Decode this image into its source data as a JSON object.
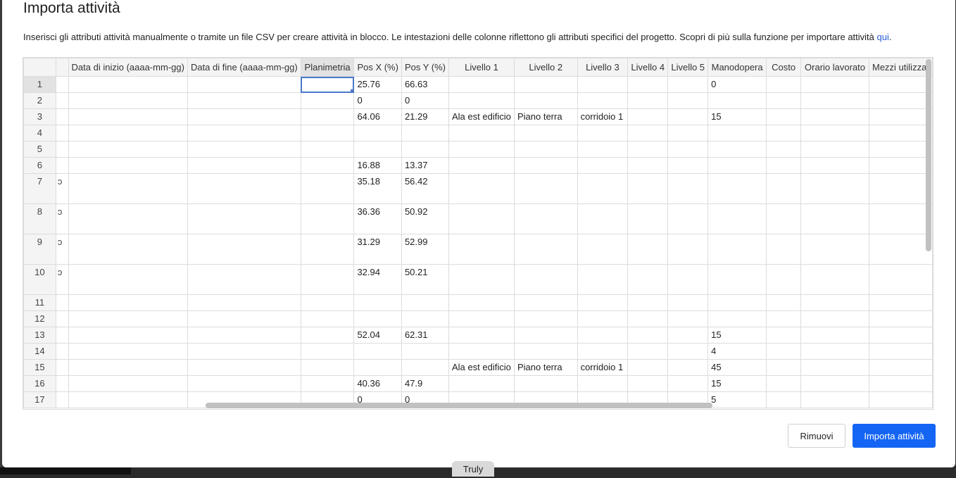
{
  "dialog": {
    "title": "Importa attività",
    "description": "Inserisci gli attributi attività manualmente o tramite un file CSV per creare attività in blocco. Le intestazioni delle colonne riflettono gli attributi specifici del progetto. Scopri di più sulla funzione per importare attività ",
    "description_link": "qui",
    "description_end": "."
  },
  "grid": {
    "columns": [
      "",
      "",
      "Data di inizio (aaaa-mm-gg)",
      "Data di fine (aaaa-mm-gg)",
      "Planimetria",
      "Pos X (%)",
      "Pos Y (%)",
      "Livello 1",
      "Livello 2",
      "Livello 3",
      "Livello 4",
      "Livello 5",
      "Manodopera",
      "Costo",
      "Orario lavorato",
      "Mezzi utilizzat"
    ],
    "rows": [
      {
        "n": "1",
        "c": [
          "",
          "",
          "",
          "",
          "25.76",
          "66.63",
          "",
          "",
          "",
          "",
          "",
          "0",
          "",
          "",
          ""
        ]
      },
      {
        "n": "2",
        "c": [
          "",
          "",
          "",
          "",
          "0",
          "0",
          "",
          "",
          "",
          "",
          "",
          "",
          "",
          "",
          ""
        ]
      },
      {
        "n": "3",
        "c": [
          "",
          "",
          "",
          "",
          "64.06",
          "21.29",
          "Ala est edificio",
          "Piano terra",
          "corridoio 1",
          "",
          "",
          "15",
          "",
          "",
          ""
        ]
      },
      {
        "n": "4",
        "c": [
          "",
          "",
          "",
          "",
          "",
          "",
          "",
          "",
          "",
          "",
          "",
          "",
          "",
          "",
          ""
        ]
      },
      {
        "n": "5",
        "c": [
          "",
          "",
          "",
          "",
          "",
          "",
          "",
          "",
          "",
          "",
          "",
          "",
          "",
          "",
          ""
        ]
      },
      {
        "n": "6",
        "c": [
          "",
          "",
          "",
          "",
          "16.88",
          "13.37",
          "",
          "",
          "",
          "",
          "",
          "",
          "",
          "",
          ""
        ]
      },
      {
        "n": "7",
        "c": [
          "ɔ",
          "",
          "",
          "",
          "35.18",
          "56.42",
          "",
          "",
          "",
          "",
          "",
          "",
          "",
          "",
          ""
        ]
      },
      {
        "n": "8",
        "c": [
          "ɔ",
          "",
          "",
          "",
          "36.36",
          "50.92",
          "",
          "",
          "",
          "",
          "",
          "",
          "",
          "",
          ""
        ]
      },
      {
        "n": "9",
        "c": [
          "ɔ",
          "",
          "",
          "",
          "31.29",
          "52.99",
          "",
          "",
          "",
          "",
          "",
          "",
          "",
          "",
          ""
        ]
      },
      {
        "n": "10",
        "c": [
          "ɔ",
          "",
          "",
          "",
          "32.94",
          "50.21",
          "",
          "",
          "",
          "",
          "",
          "",
          "",
          "",
          ""
        ]
      },
      {
        "n": "11",
        "c": [
          "",
          "",
          "",
          "",
          "",
          "",
          "",
          "",
          "",
          "",
          "",
          "",
          "",
          "",
          ""
        ]
      },
      {
        "n": "12",
        "c": [
          "",
          "",
          "",
          "",
          "",
          "",
          "",
          "",
          "",
          "",
          "",
          "",
          "",
          "",
          ""
        ]
      },
      {
        "n": "13",
        "c": [
          "",
          "",
          "",
          "",
          "52.04",
          "62.31",
          "",
          "",
          "",
          "",
          "",
          "15",
          "",
          "",
          ""
        ]
      },
      {
        "n": "14",
        "c": [
          "",
          "",
          "",
          "",
          "",
          "",
          "",
          "",
          "",
          "",
          "",
          "4",
          "",
          "",
          ""
        ]
      },
      {
        "n": "15",
        "c": [
          "",
          "",
          "",
          "",
          "",
          "",
          "Ala est edificio",
          "Piano terra",
          "corridoio 1",
          "",
          "",
          "45",
          "",
          "",
          ""
        ]
      },
      {
        "n": "16",
        "c": [
          "",
          "",
          "",
          "",
          "40.36",
          "47.9",
          "",
          "",
          "",
          "",
          "",
          "15",
          "",
          "",
          ""
        ]
      },
      {
        "n": "17",
        "c": [
          "",
          "",
          "",
          "",
          "0",
          "0",
          "",
          "",
          "",
          "",
          "",
          "5",
          "",
          "",
          ""
        ]
      }
    ]
  },
  "buttons": {
    "remove": "Rimuovi",
    "import": "Importa attività"
  },
  "footer_tab": "Truly"
}
